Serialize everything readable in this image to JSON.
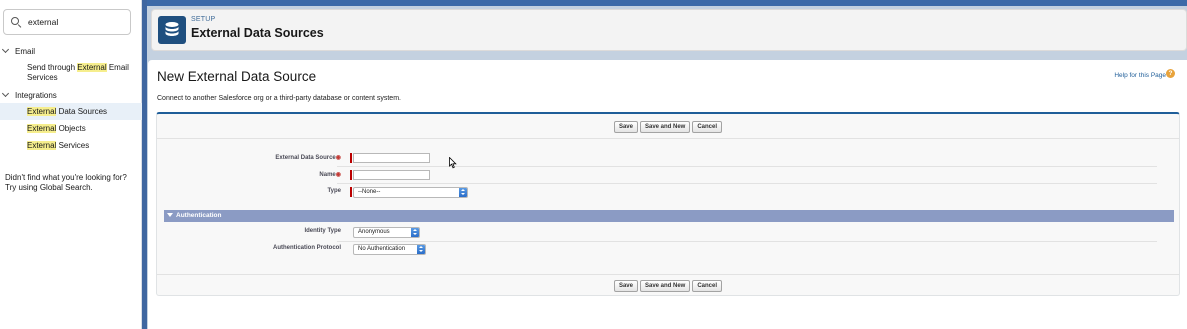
{
  "sidebar": {
    "search_value": "external",
    "groups": [
      {
        "label": "Email",
        "items": [
          {
            "pre": "Send through ",
            "hl": "External",
            "post": " Email Services"
          }
        ]
      },
      {
        "label": "Integrations",
        "items": [
          {
            "pre": "",
            "hl": "External",
            "post": " Data Sources"
          },
          {
            "pre": "",
            "hl": "External",
            "post": " Objects"
          },
          {
            "pre": "",
            "hl": "External",
            "post": " Services"
          }
        ]
      }
    ],
    "not_found": "Didn't find what you're looking for? Try using Global Search."
  },
  "header": {
    "setup_label": "SETUP",
    "title": "External Data Sources",
    "icon": "database-icon"
  },
  "page": {
    "title": "New External Data Source",
    "help_link": "Help for this Page",
    "subtitle": "Connect to another Salesforce org or a third-party database or content system."
  },
  "buttons": {
    "save": "Save",
    "save_and_new": "Save and New",
    "cancel": "Cancel"
  },
  "form": {
    "external_data_source_label": "External Data Source",
    "external_data_source_value": "",
    "name_label": "Name",
    "name_value": "",
    "type_label": "Type",
    "type_value": "--None--"
  },
  "authentication": {
    "section_title": "Authentication",
    "identity_type_label": "Identity Type",
    "identity_type_value": "Anonymous",
    "protocol_label": "Authentication Protocol",
    "protocol_value": "No Authentication"
  },
  "colors": {
    "accent": "#1f5e99",
    "section_header": "#8b9bc4",
    "highlight": "#f6ee8d",
    "required": "#b00000"
  }
}
